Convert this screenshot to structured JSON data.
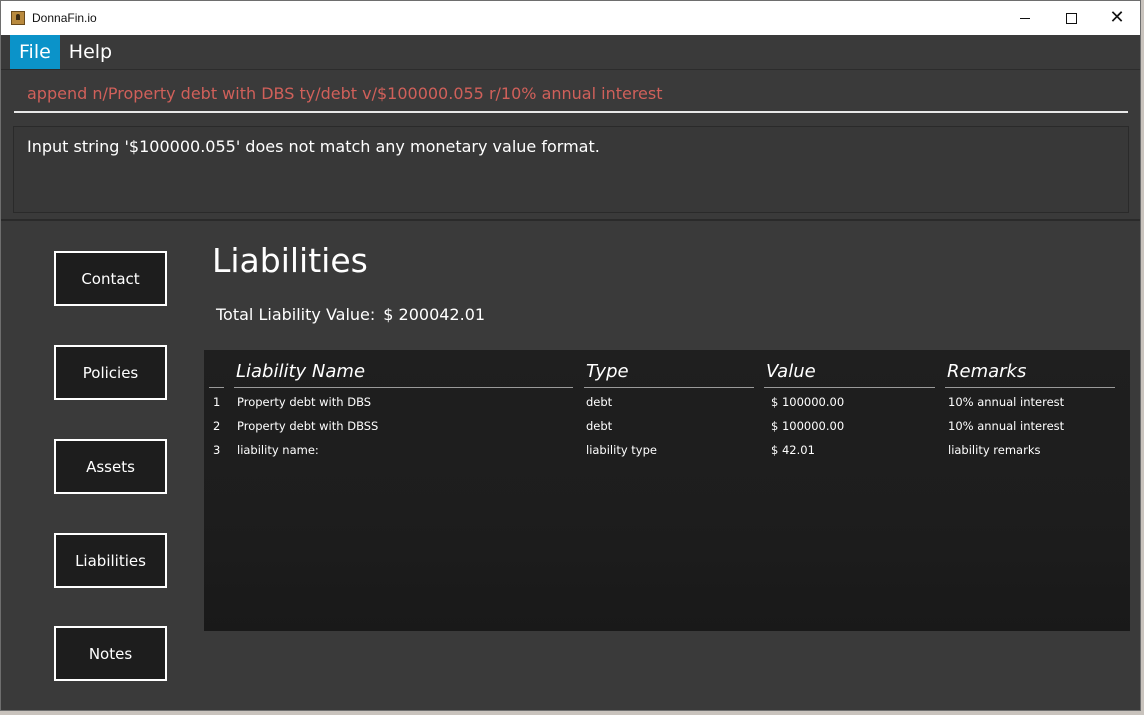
{
  "window": {
    "title": "DonnaFin.io",
    "controls": {
      "minimize_icon": "minimize-icon",
      "maximize_icon": "maximize-icon",
      "close_icon": "close-icon"
    }
  },
  "menu": {
    "items": [
      {
        "label": "File",
        "active": true
      },
      {
        "label": "Help",
        "active": false
      }
    ]
  },
  "command": {
    "text": "append n/Property debt with DBS ty/debt v/$100000.055 r/10% annual interest",
    "color": "#d0605a"
  },
  "result": {
    "text": "Input string '$100000.055' does not match any monetary value format."
  },
  "nav": {
    "buttons": [
      "Contact",
      "Policies",
      "Assets",
      "Liabilities",
      "Notes"
    ]
  },
  "panel": {
    "title": "Liabilities",
    "total_label": "Total Liability Value:",
    "total_value": "$ 200042.01"
  },
  "table": {
    "headers": [
      "Liability Name",
      "Type",
      "Value",
      "Remarks"
    ],
    "rows": [
      {
        "index": "1",
        "name": "Property debt with DBS",
        "type": "debt",
        "value": "$ 100000.00",
        "remarks": "10% annual interest"
      },
      {
        "index": "2",
        "name": "Property debt with DBSS",
        "type": "debt",
        "value": "$ 100000.00",
        "remarks": "10% annual interest"
      },
      {
        "index": "3",
        "name": "liability name:",
        "type": "liability type",
        "value": "$ 42.01",
        "remarks": "liability remarks"
      }
    ]
  },
  "colors": {
    "accent": "#0b93c9",
    "background": "#3a3a3a",
    "table_bg": "#1e1e1e",
    "error_text": "#d0605a"
  }
}
